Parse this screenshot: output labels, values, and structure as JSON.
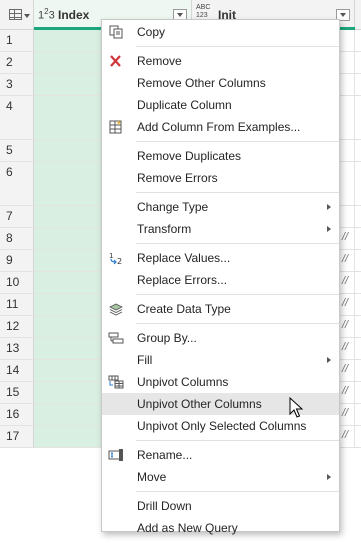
{
  "grid": {
    "columns": [
      {
        "type_label": "1²3",
        "name": "Index"
      },
      {
        "type_label": "ABC 123",
        "name": "Init"
      }
    ],
    "rows": [
      {
        "num": "1",
        "tall": false,
        "slash": ""
      },
      {
        "num": "2",
        "tall": false,
        "slash": ""
      },
      {
        "num": "3",
        "tall": false,
        "slash": ""
      },
      {
        "num": "4",
        "tall": true,
        "slash": ""
      },
      {
        "num": "5",
        "tall": false,
        "slash": ""
      },
      {
        "num": "6",
        "tall": true,
        "slash": ""
      },
      {
        "num": "7",
        "tall": false,
        "slash": ""
      },
      {
        "num": "8",
        "tall": false,
        "slash": "//"
      },
      {
        "num": "9",
        "tall": false,
        "slash": "//"
      },
      {
        "num": "10",
        "tall": false,
        "slash": "//"
      },
      {
        "num": "11",
        "tall": false,
        "slash": "//"
      },
      {
        "num": "12",
        "tall": false,
        "slash": "//"
      },
      {
        "num": "13",
        "tall": false,
        "slash": "//"
      },
      {
        "num": "14",
        "tall": false,
        "slash": "//"
      },
      {
        "num": "15",
        "tall": false,
        "slash": "//"
      },
      {
        "num": "16",
        "tall": false,
        "slash": "//"
      },
      {
        "num": "17",
        "tall": false,
        "slash": "//"
      }
    ]
  },
  "menu": {
    "copy": "Copy",
    "remove": "Remove",
    "remove_other_columns": "Remove Other Columns",
    "duplicate_column": "Duplicate Column",
    "add_column_from_examples": "Add Column From Examples...",
    "remove_duplicates": "Remove Duplicates",
    "remove_errors": "Remove Errors",
    "change_type": "Change Type",
    "transform": "Transform",
    "replace_values": "Replace Values...",
    "replace_errors": "Replace Errors...",
    "create_data_type": "Create Data Type",
    "group_by": "Group By...",
    "fill": "Fill",
    "unpivot_columns": "Unpivot Columns",
    "unpivot_other_columns": "Unpivot Other Columns",
    "unpivot_only_selected_columns": "Unpivot Only Selected Columns",
    "rename": "Rename...",
    "move": "Move",
    "drill_down": "Drill Down",
    "add_as_new_query": "Add as New Query",
    "hovered_item": "Unpivot Other Columns"
  },
  "colors": {
    "accent_green": "#1ba67c",
    "selected_column_bg": "#d9efe1",
    "remove_icon_red": "#d13438"
  }
}
